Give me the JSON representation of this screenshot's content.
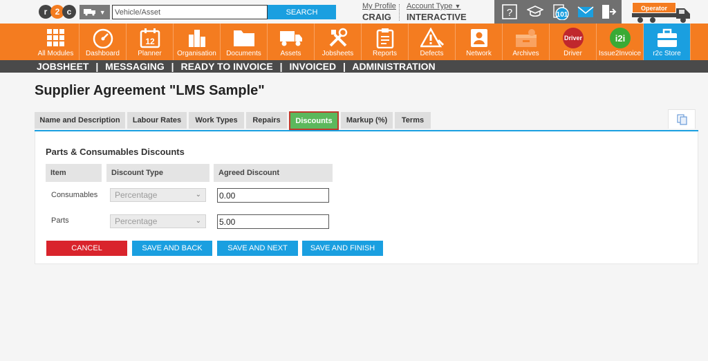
{
  "top": {
    "logo": "r2c",
    "search_placeholder": "Vehicle/Asset",
    "search_button": "SEARCH",
    "my_profile_link": "My Profile",
    "profile_name": "CRAIG",
    "account_type_link": "Account Type",
    "account_type_value": "INTERACTIVE",
    "notification_count": "101",
    "operator_label": "Operator"
  },
  "modules": [
    {
      "label": "All Modules",
      "icon": "grid-icon"
    },
    {
      "label": "Dashboard",
      "icon": "speedometer-icon"
    },
    {
      "label": "Planner",
      "icon": "calendar-icon",
      "badge": "12"
    },
    {
      "label": "Organisation",
      "icon": "buildings-icon"
    },
    {
      "label": "Documents",
      "icon": "folder-icon"
    },
    {
      "label": "Assets",
      "icon": "truck-icon"
    },
    {
      "label": "Jobsheets",
      "icon": "tools-icon"
    },
    {
      "label": "Reports",
      "icon": "clipboard-icon"
    },
    {
      "label": "Defects",
      "icon": "warning-icon"
    },
    {
      "label": "Network",
      "icon": "contact-card-icon"
    },
    {
      "label": "Archives",
      "icon": "archive-icon"
    },
    {
      "label": "Driver",
      "icon": "driver-icon",
      "badge": "Driver"
    },
    {
      "label": "Issue2Invoice",
      "icon": "i2i-icon",
      "badge": "i2i"
    },
    {
      "label": "r2c Store",
      "icon": "briefcase-icon"
    }
  ],
  "nav": [
    "JOBSHEET",
    "MESSAGING",
    "READY TO INVOICE",
    "INVOICED",
    "ADMINISTRATION"
  ],
  "nav_sep": "|",
  "page_title": "Supplier Agreement \"LMS Sample\"",
  "tabs": [
    "Name and Description",
    "Labour Rates",
    "Work Types",
    "Repairs",
    "Discounts",
    "Markup (%)",
    "Terms"
  ],
  "active_tab": "Discounts",
  "section_title": "Parts & Consumables Discounts",
  "table": {
    "headers": [
      "Item",
      "Discount Type",
      "Agreed Discount"
    ],
    "rows": [
      {
        "item": "Consumables",
        "discount_type": "Percentage",
        "agreed_discount": "0.00"
      },
      {
        "item": "Parts",
        "discount_type": "Percentage",
        "agreed_discount": "5.00"
      }
    ]
  },
  "buttons": {
    "cancel": "CANCEL",
    "save_back": "SAVE AND BACK",
    "save_next": "SAVE AND NEXT",
    "save_finish": "SAVE AND FINISH"
  },
  "colors": {
    "orange": "#f47c20",
    "blue": "#1a9fe0",
    "active_tab": "#5cb85c",
    "cancel": "#d9242c",
    "nav_bg": "#4a4a4a"
  }
}
